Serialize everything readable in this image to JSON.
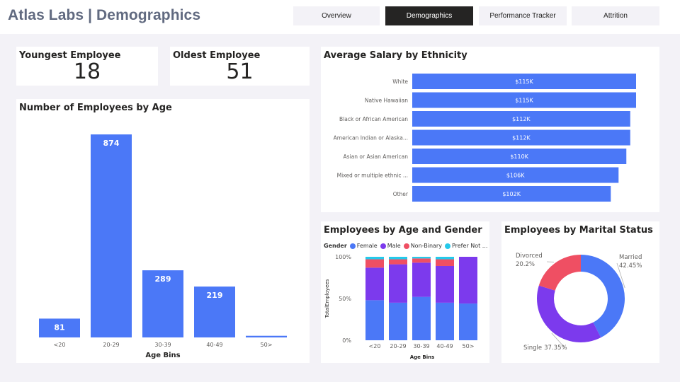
{
  "header": {
    "title": "Atlas Labs | Demographics",
    "tabs": [
      {
        "label": "Overview",
        "active": false
      },
      {
        "label": "Demographics",
        "active": true
      },
      {
        "label": "Performance Tracker",
        "active": false
      },
      {
        "label": "Attrition",
        "active": false
      }
    ]
  },
  "kpis": {
    "youngest": {
      "label": "Youngest Employee",
      "value": "18"
    },
    "oldest": {
      "label": "Oldest Employee",
      "value": "51"
    }
  },
  "colors": {
    "blue": "#4b78f7",
    "purple": "#7c3aed",
    "red": "#ef4f63",
    "cyan": "#25c9ea"
  },
  "chart_data": [
    {
      "id": "age",
      "type": "bar",
      "title": "Number of Employees by Age",
      "xlabel": "Age Bins",
      "ylabel": "",
      "categories": [
        "<20",
        "20-29",
        "30-39",
        "40-49",
        "50>"
      ],
      "values": [
        81,
        874,
        289,
        219,
        7
      ],
      "labels": [
        "81",
        "874",
        "289",
        "219",
        ""
      ],
      "ylim": [
        0,
        874
      ],
      "grid": false,
      "color": "#4b78f7"
    },
    {
      "id": "salary",
      "type": "bar",
      "orientation": "horizontal",
      "title": "Average Salary by Ethnicity",
      "xlabel": "",
      "ylabel": "",
      "categories": [
        "White",
        "Native Hawaiian",
        "Black or African American",
        "American Indian or Alaska...",
        "Asian or Asian American",
        "Mixed or multiple ethnic ...",
        "Other"
      ],
      "values": [
        115,
        115,
        112,
        112,
        110,
        106,
        102
      ],
      "labels": [
        "$115K",
        "$115K",
        "$112K",
        "$112K",
        "$110K",
        "$106K",
        "$102K"
      ],
      "unit": "$K",
      "xlim": [
        0,
        115
      ],
      "grid": false,
      "color": "#4b78f7"
    },
    {
      "id": "agegender",
      "type": "bar",
      "stacked": "percent",
      "title": "Employees by Age and Gender",
      "xlabel": "Age Bins",
      "ylabel": "TotalEmployees",
      "legend_title": "Gender",
      "legend_position": "top-left",
      "categories": [
        "<20",
        "20-29",
        "30-39",
        "40-49",
        "50>"
      ],
      "series": [
        {
          "name": "Female",
          "values": [
            48,
            45,
            52,
            45,
            44
          ],
          "color": "#4b78f7"
        },
        {
          "name": "Male",
          "values": [
            39,
            46,
            41,
            44,
            56
          ],
          "color": "#7c3aed"
        },
        {
          "name": "Non-Binary",
          "values": [
            10,
            6,
            5,
            8,
            0
          ],
          "color": "#ef4f63"
        },
        {
          "name": "Prefer Not ...",
          "values": [
            3,
            3,
            2,
            3,
            0
          ],
          "color": "#25c9ea"
        }
      ],
      "yticks": [
        "0%",
        "50%",
        "100%"
      ],
      "ylim": [
        0,
        100
      ],
      "grid": false
    },
    {
      "id": "marital",
      "type": "pie",
      "donut": true,
      "title": "Employees by Marital Status",
      "slices": [
        {
          "name": "Married",
          "value": 42.45,
          "label": "Married",
          "pct": "42.45%",
          "color": "#4b78f7"
        },
        {
          "name": "Single",
          "value": 37.35,
          "label": "Single",
          "pct": "37.35%",
          "color": "#7c3aed"
        },
        {
          "name": "Divorced",
          "value": 20.2,
          "label": "Divorced",
          "pct": "20.2%",
          "color": "#ef4f63"
        }
      ]
    }
  ]
}
